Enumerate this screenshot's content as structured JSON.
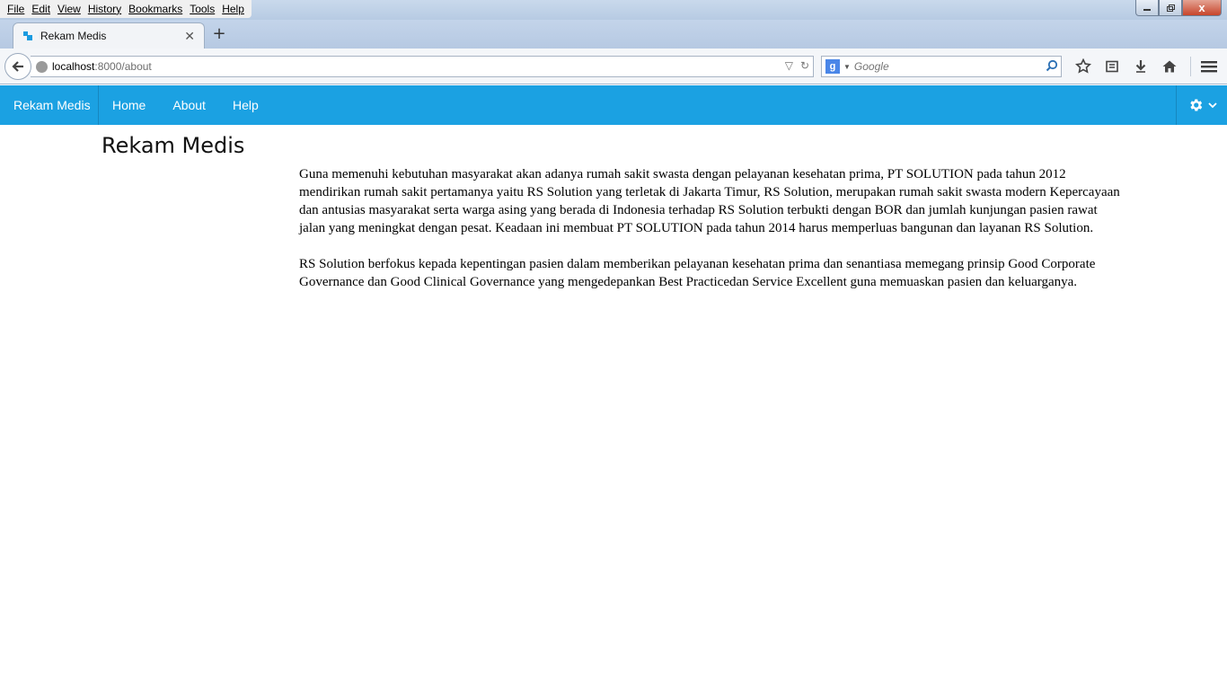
{
  "browser": {
    "menu": [
      "File",
      "Edit",
      "View",
      "History",
      "Bookmarks",
      "Tools",
      "Help"
    ],
    "tab": {
      "title": "Rekam Medis"
    },
    "url": {
      "host": "localhost",
      "path": ":8000/about"
    },
    "search": {
      "engine": "g",
      "placeholder": "Google"
    },
    "window_controls": {
      "close": "x"
    }
  },
  "site": {
    "brand": "Rekam Medis",
    "nav": [
      "Home",
      "About",
      "Help"
    ],
    "colors": {
      "navbar": "#1ba1e2"
    }
  },
  "page": {
    "title": "Rekam Medis",
    "paragraphs": [
      "Guna memenuhi kebutuhan masyarakat akan adanya rumah sakit swasta dengan pelayanan kesehatan prima, PT SOLUTION pada tahun 2012 mendirikan rumah sakit pertamanya yaitu RS Solution yang terletak di Jakarta Timur, RS Solution, merupakan rumah sakit swasta modern Kepercayaan dan antusias masyarakat serta warga asing yang berada di Indonesia terhadap RS Solution terbukti dengan BOR dan jumlah kunjungan pasien rawat jalan yang meningkat dengan pesat. Keadaan ini membuat PT SOLUTION pada tahun 2014 harus memperluas bangunan dan layanan RS Solution.",
      "RS Solution berfokus kepada kepentingan pasien dalam memberikan pelayanan kesehatan prima dan senantiasa memegang prinsip Good Corporate Governance dan Good Clinical Governance yang mengedepankan Best Practicedan Service Excellent guna memuaskan pasien dan keluarganya."
    ]
  }
}
